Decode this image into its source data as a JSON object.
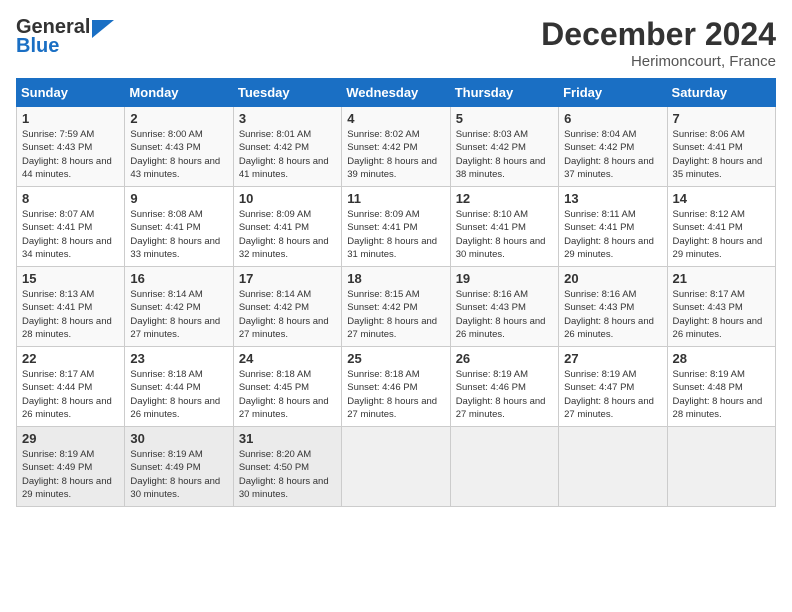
{
  "header": {
    "logo_general": "General",
    "logo_blue": "Blue",
    "title": "December 2024",
    "subtitle": "Herimoncourt, France"
  },
  "days_of_week": [
    "Sunday",
    "Monday",
    "Tuesday",
    "Wednesday",
    "Thursday",
    "Friday",
    "Saturday"
  ],
  "weeks": [
    [
      {
        "day": "1",
        "sunrise": "Sunrise: 7:59 AM",
        "sunset": "Sunset: 4:43 PM",
        "daylight": "Daylight: 8 hours and 44 minutes."
      },
      {
        "day": "2",
        "sunrise": "Sunrise: 8:00 AM",
        "sunset": "Sunset: 4:43 PM",
        "daylight": "Daylight: 8 hours and 43 minutes."
      },
      {
        "day": "3",
        "sunrise": "Sunrise: 8:01 AM",
        "sunset": "Sunset: 4:42 PM",
        "daylight": "Daylight: 8 hours and 41 minutes."
      },
      {
        "day": "4",
        "sunrise": "Sunrise: 8:02 AM",
        "sunset": "Sunset: 4:42 PM",
        "daylight": "Daylight: 8 hours and 39 minutes."
      },
      {
        "day": "5",
        "sunrise": "Sunrise: 8:03 AM",
        "sunset": "Sunset: 4:42 PM",
        "daylight": "Daylight: 8 hours and 38 minutes."
      },
      {
        "day": "6",
        "sunrise": "Sunrise: 8:04 AM",
        "sunset": "Sunset: 4:42 PM",
        "daylight": "Daylight: 8 hours and 37 minutes."
      },
      {
        "day": "7",
        "sunrise": "Sunrise: 8:06 AM",
        "sunset": "Sunset: 4:41 PM",
        "daylight": "Daylight: 8 hours and 35 minutes."
      }
    ],
    [
      {
        "day": "8",
        "sunrise": "Sunrise: 8:07 AM",
        "sunset": "Sunset: 4:41 PM",
        "daylight": "Daylight: 8 hours and 34 minutes."
      },
      {
        "day": "9",
        "sunrise": "Sunrise: 8:08 AM",
        "sunset": "Sunset: 4:41 PM",
        "daylight": "Daylight: 8 hours and 33 minutes."
      },
      {
        "day": "10",
        "sunrise": "Sunrise: 8:09 AM",
        "sunset": "Sunset: 4:41 PM",
        "daylight": "Daylight: 8 hours and 32 minutes."
      },
      {
        "day": "11",
        "sunrise": "Sunrise: 8:09 AM",
        "sunset": "Sunset: 4:41 PM",
        "daylight": "Daylight: 8 hours and 31 minutes."
      },
      {
        "day": "12",
        "sunrise": "Sunrise: 8:10 AM",
        "sunset": "Sunset: 4:41 PM",
        "daylight": "Daylight: 8 hours and 30 minutes."
      },
      {
        "day": "13",
        "sunrise": "Sunrise: 8:11 AM",
        "sunset": "Sunset: 4:41 PM",
        "daylight": "Daylight: 8 hours and 29 minutes."
      },
      {
        "day": "14",
        "sunrise": "Sunrise: 8:12 AM",
        "sunset": "Sunset: 4:41 PM",
        "daylight": "Daylight: 8 hours and 29 minutes."
      }
    ],
    [
      {
        "day": "15",
        "sunrise": "Sunrise: 8:13 AM",
        "sunset": "Sunset: 4:41 PM",
        "daylight": "Daylight: 8 hours and 28 minutes."
      },
      {
        "day": "16",
        "sunrise": "Sunrise: 8:14 AM",
        "sunset": "Sunset: 4:42 PM",
        "daylight": "Daylight: 8 hours and 27 minutes."
      },
      {
        "day": "17",
        "sunrise": "Sunrise: 8:14 AM",
        "sunset": "Sunset: 4:42 PM",
        "daylight": "Daylight: 8 hours and 27 minutes."
      },
      {
        "day": "18",
        "sunrise": "Sunrise: 8:15 AM",
        "sunset": "Sunset: 4:42 PM",
        "daylight": "Daylight: 8 hours and 27 minutes."
      },
      {
        "day": "19",
        "sunrise": "Sunrise: 8:16 AM",
        "sunset": "Sunset: 4:43 PM",
        "daylight": "Daylight: 8 hours and 26 minutes."
      },
      {
        "day": "20",
        "sunrise": "Sunrise: 8:16 AM",
        "sunset": "Sunset: 4:43 PM",
        "daylight": "Daylight: 8 hours and 26 minutes."
      },
      {
        "day": "21",
        "sunrise": "Sunrise: 8:17 AM",
        "sunset": "Sunset: 4:43 PM",
        "daylight": "Daylight: 8 hours and 26 minutes."
      }
    ],
    [
      {
        "day": "22",
        "sunrise": "Sunrise: 8:17 AM",
        "sunset": "Sunset: 4:44 PM",
        "daylight": "Daylight: 8 hours and 26 minutes."
      },
      {
        "day": "23",
        "sunrise": "Sunrise: 8:18 AM",
        "sunset": "Sunset: 4:44 PM",
        "daylight": "Daylight: 8 hours and 26 minutes."
      },
      {
        "day": "24",
        "sunrise": "Sunrise: 8:18 AM",
        "sunset": "Sunset: 4:45 PM",
        "daylight": "Daylight: 8 hours and 27 minutes."
      },
      {
        "day": "25",
        "sunrise": "Sunrise: 8:18 AM",
        "sunset": "Sunset: 4:46 PM",
        "daylight": "Daylight: 8 hours and 27 minutes."
      },
      {
        "day": "26",
        "sunrise": "Sunrise: 8:19 AM",
        "sunset": "Sunset: 4:46 PM",
        "daylight": "Daylight: 8 hours and 27 minutes."
      },
      {
        "day": "27",
        "sunrise": "Sunrise: 8:19 AM",
        "sunset": "Sunset: 4:47 PM",
        "daylight": "Daylight: 8 hours and 27 minutes."
      },
      {
        "day": "28",
        "sunrise": "Sunrise: 8:19 AM",
        "sunset": "Sunset: 4:48 PM",
        "daylight": "Daylight: 8 hours and 28 minutes."
      }
    ],
    [
      {
        "day": "29",
        "sunrise": "Sunrise: 8:19 AM",
        "sunset": "Sunset: 4:49 PM",
        "daylight": "Daylight: 8 hours and 29 minutes."
      },
      {
        "day": "30",
        "sunrise": "Sunrise: 8:19 AM",
        "sunset": "Sunset: 4:49 PM",
        "daylight": "Daylight: 8 hours and 30 minutes."
      },
      {
        "day": "31",
        "sunrise": "Sunrise: 8:20 AM",
        "sunset": "Sunset: 4:50 PM",
        "daylight": "Daylight: 8 hours and 30 minutes."
      },
      null,
      null,
      null,
      null
    ]
  ],
  "accent_color": "#1a6fc4"
}
